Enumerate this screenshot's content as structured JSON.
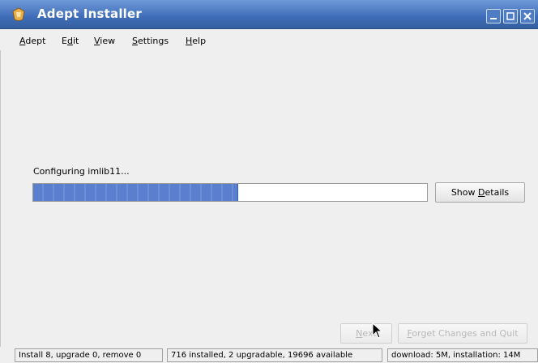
{
  "window": {
    "title": "Adept Installer",
    "icon": "adept-app-icon"
  },
  "menu": {
    "adept": {
      "pre": "",
      "u": "A",
      "post": "dept"
    },
    "edit": {
      "pre": "E",
      "u": "d",
      "post": "it"
    },
    "view": {
      "pre": "",
      "u": "V",
      "post": "iew"
    },
    "settings": {
      "pre": "",
      "u": "S",
      "post": "ettings"
    },
    "help": {
      "pre": "",
      "u": "H",
      "post": "elp"
    }
  },
  "progress": {
    "label": "Configuring imlib11...",
    "value": 0.52,
    "text": "52%"
  },
  "buttons": {
    "show_details": {
      "pre": "Show ",
      "u": "D",
      "post": "etails"
    },
    "next": {
      "pre": "",
      "u": "N",
      "post": "ext"
    },
    "forget": {
      "pre": "",
      "u": "F",
      "post": "orget Changes and Quit"
    }
  },
  "status": {
    "actions": "Install 8, upgrade 0, remove 0",
    "counts": "716 installed, 2 upgradable, 19696 available",
    "sizes": "download: 5M, installation: 14M"
  },
  "colors": {
    "titlebar": "#3f6cb8",
    "progress_fill": "#5a7fcf",
    "background": "#efefef"
  }
}
